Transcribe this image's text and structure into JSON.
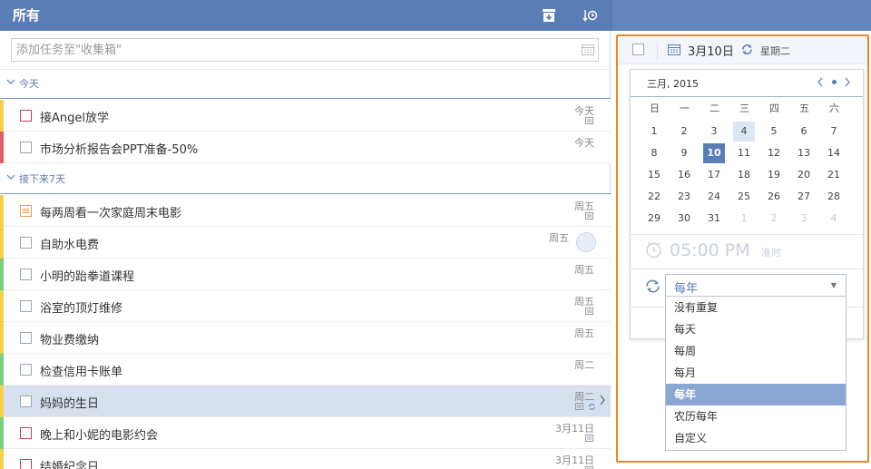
{
  "header": {
    "title": "所有",
    "archive_icon": "archive-icon",
    "sort_icon": "sort-by-time-icon"
  },
  "add_task": {
    "placeholder": "添加任务至\"收集箱\"",
    "date_icon": "calendar-icon"
  },
  "sections": [
    {
      "label": "今天"
    },
    {
      "label": "接下来7天"
    }
  ],
  "tasks": [
    {
      "name": "接Angel放学",
      "due": "今天",
      "priority_color": "#f2d14a",
      "checkbox": "red"
    },
    {
      "name": "市场分析报告会PPT准备-50%",
      "due": "今天",
      "priority_color": "#e05a6b",
      "checkbox": "normal"
    },
    {
      "name": "每两周看一次家庭周末电影",
      "due": "周五",
      "priority_color": "#f2d14a",
      "checkbox": "orange-checklist"
    },
    {
      "name": "自助水电费",
      "due": "周五",
      "priority_color": "#f2d14a",
      "checkbox": "normal",
      "assignee": "avatar"
    },
    {
      "name": "小明的跆拳道课程",
      "due": "周五",
      "priority_color": "#7ccf7c",
      "checkbox": "normal"
    },
    {
      "name": "浴室的顶灯维修",
      "due": "周五",
      "priority_color": "#f2d14a",
      "checkbox": "normal"
    },
    {
      "name": "物业费缴纳",
      "due": "周五",
      "priority_color": "#f2d14a",
      "checkbox": "normal"
    },
    {
      "name": "检查信用卡账单",
      "due": "周二",
      "priority_color": "#7ccf7c",
      "checkbox": "normal"
    },
    {
      "name": "妈妈的生日",
      "due": "周二",
      "priority_color": "#f2d14a",
      "checkbox": "normal",
      "selected": true
    },
    {
      "name": "晚上和小妮的电影约会",
      "due": "3月11日",
      "priority_color": "#7ccf7c",
      "checkbox": "red"
    },
    {
      "name": "结婚纪念日",
      "due": "3月11日",
      "priority_color": "#f2d14a",
      "checkbox": "red"
    }
  ],
  "detail": {
    "date": "3月10日",
    "weekday": "星期二",
    "calendar": {
      "month_label": "三月, 2015",
      "weekdays": [
        "日",
        "一",
        "二",
        "三",
        "四",
        "五",
        "六"
      ],
      "weeks": [
        [
          "1",
          "2",
          "3",
          "4",
          "5",
          "6",
          "7"
        ],
        [
          "8",
          "9",
          "10",
          "11",
          "12",
          "13",
          "14"
        ],
        [
          "15",
          "16",
          "17",
          "18",
          "19",
          "20",
          "21"
        ],
        [
          "22",
          "23",
          "24",
          "25",
          "26",
          "27",
          "28"
        ],
        [
          "29",
          "30",
          "31",
          "1",
          "2",
          "3",
          "4"
        ]
      ],
      "selected_day": "10",
      "today_day": "4"
    },
    "time": "05:00 PM",
    "time_option": "准时",
    "repeat": {
      "selected": "每年",
      "options": [
        "没有重复",
        "每天",
        "每周",
        "每月",
        "每年",
        "农历每年",
        "自定义"
      ]
    }
  },
  "colors": {
    "accent": "#5b7db5",
    "highlight": "#f0842c",
    "selected_row": "#d7e0ee"
  }
}
